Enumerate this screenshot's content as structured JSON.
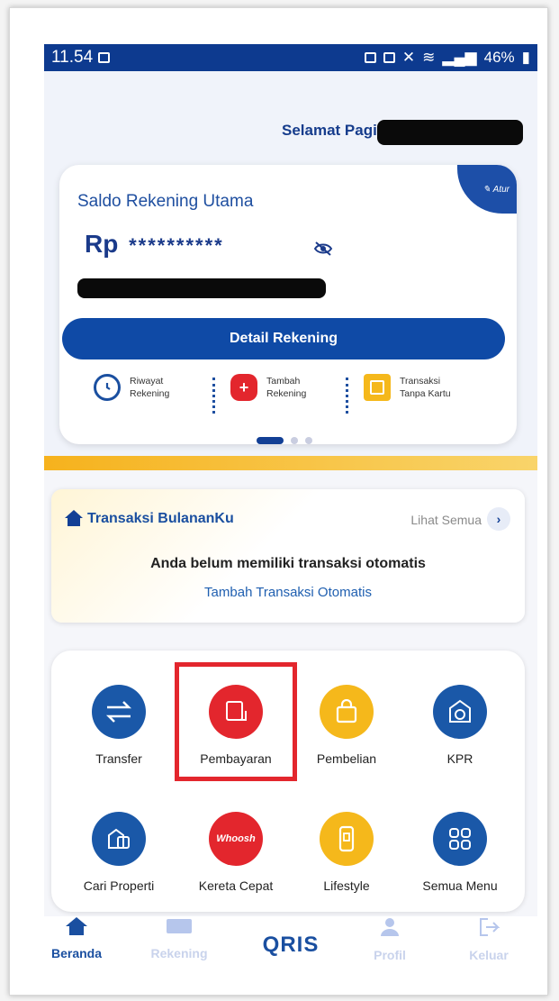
{
  "status_bar": {
    "time": "11.54",
    "battery": "46%"
  },
  "greeting": "Selamat Pagi,",
  "account_card": {
    "title": "Saldo Rekening Utama",
    "currency": "Rp",
    "masked_balance": "**********",
    "atur_label": "Atur",
    "detail_button": "Detail Rekening",
    "actions": [
      {
        "line1": "Riwayat",
        "line2": "Rekening"
      },
      {
        "line1": "Tambah",
        "line2": "Rekening"
      },
      {
        "line1": "Transaksi",
        "line2": "Tanpa Kartu"
      }
    ]
  },
  "monthly": {
    "title": "Transaksi BulananKu",
    "see_all": "Lihat Semua",
    "empty_message": "Anda belum memiliki transaksi otomatis",
    "add_link": "Tambah Transaksi Otomatis"
  },
  "menu": {
    "items": [
      {
        "label": "Transfer",
        "color": "#1a58a8"
      },
      {
        "label": "Pembayaran",
        "color": "#e3262d"
      },
      {
        "label": "Pembelian",
        "color": "#f5b81b"
      },
      {
        "label": "KPR",
        "color": "#1a58a8"
      },
      {
        "label": "Cari Properti",
        "color": "#1a58a8"
      },
      {
        "label": "Kereta Cepat",
        "color": "#e3262d",
        "badge": "Whoosh"
      },
      {
        "label": "Lifestyle",
        "color": "#f5b81b"
      },
      {
        "label": "Semua Menu",
        "color": "#1a58a8"
      }
    ]
  },
  "tabs": [
    {
      "label": "Beranda",
      "active": true
    },
    {
      "label": "Rekening",
      "active": false
    },
    {
      "label": "QRIS",
      "active": false
    },
    {
      "label": "Profil",
      "active": false
    },
    {
      "label": "Keluar",
      "active": false
    }
  ],
  "colors": {
    "primary": "#0f4aa6",
    "accent_yellow": "#f5b81b",
    "accent_red": "#e3262d"
  }
}
